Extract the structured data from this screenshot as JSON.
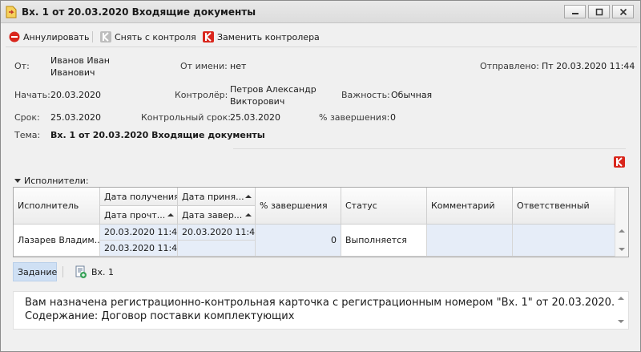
{
  "window": {
    "title": "Вх. 1 от 20.03.2020 Входящие документы"
  },
  "toolbar": {
    "cancel_label": "Аннулировать",
    "remove_control_label": "Снять с контроля",
    "replace_controller_label": "Заменить контролера"
  },
  "header": {
    "from_label": "От:",
    "from_value": "Иванов Иван\nИванович",
    "on_behalf_label": "От имени:",
    "on_behalf_value": "нет",
    "sent_label": "Отправлено:",
    "sent_value": "Пт 20.03.2020 11:44",
    "start_label": "Начать:",
    "start_value": "20.03.2020",
    "controller_label": "Контролёр:",
    "controller_value": "Петров Александр\nВикторович",
    "importance_label": "Важность:",
    "importance_value": "Обычная",
    "deadline_label": "Срок:",
    "deadline_value": "25.03.2020",
    "control_deadline_label": "Контрольный срок:",
    "control_deadline_value": "25.03.2020",
    "completion_label": "% завершения:",
    "completion_value": "0",
    "subject_label": "Тема:",
    "subject_value": "Вх. 1 от 20.03.2020 Входящие документы"
  },
  "executors": {
    "section_label": "Исполнители:",
    "columns": {
      "executor": "Исполнитель",
      "received": "Дата получения",
      "accepted": "Дата приня...",
      "read": "Дата прочт...",
      "completed": "Дата завер...",
      "percent": "% завершения",
      "status": "Статус",
      "comment": "Комментарий",
      "responsible": "Ответственный"
    },
    "rows": [
      {
        "executor": "Лазарев Владим...",
        "received": "20.03.2020 11:4...",
        "accepted": "20.03.2020 11:4...",
        "read": "20.03.2020 11:4...",
        "completed": "",
        "percent": "0",
        "status": "Выполняется",
        "comment": "",
        "responsible": ""
      }
    ]
  },
  "tabs": {
    "task_label": "Задание",
    "doc_label": "Вх. 1"
  },
  "task_text": {
    "line1": "Вам назначена регистрационно-контрольная карточка с регистрационным номером \"Вх. 1\" от 20.03.2020.",
    "line2": "Содержание: Договор поставки комплектующих"
  },
  "colors": {
    "accent_red": "#d9261c",
    "selection_blue": "#e6edf8",
    "active_tab": "#cfe0f4"
  },
  "icons": {
    "app": "document-arrow-icon",
    "cancel": "stop-circle-icon",
    "remove_control": "k-grey-icon",
    "replace_controller": "k-red-icon",
    "doc": "document-link-icon"
  }
}
